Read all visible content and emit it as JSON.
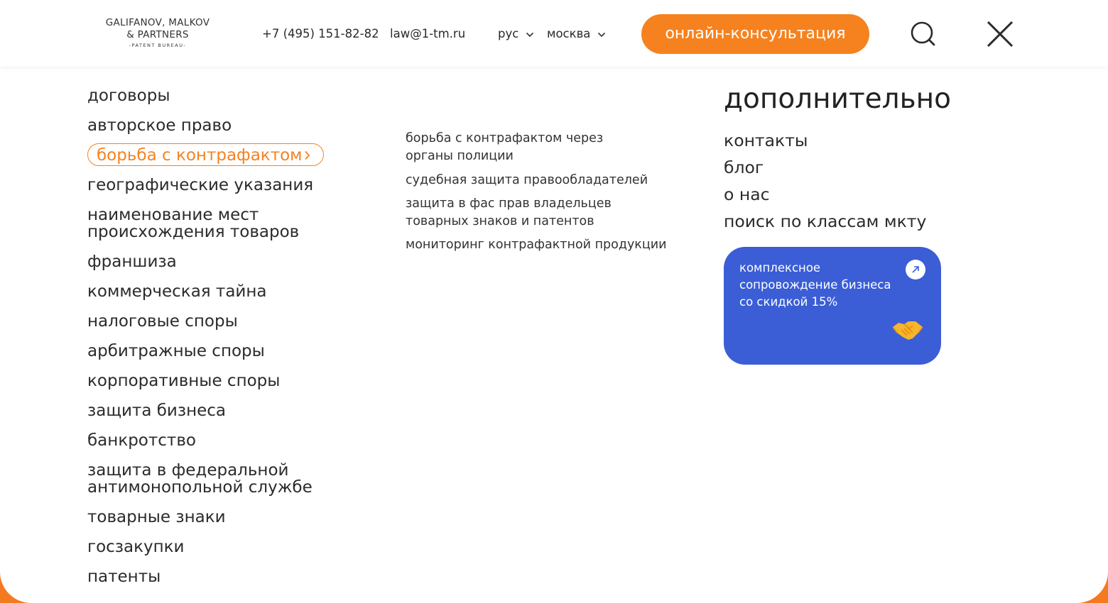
{
  "colors": {
    "accent": "#f6821f",
    "promo_bg": "#3b5ed6",
    "text": "#222222"
  },
  "header": {
    "logo": {
      "line1": "GALIFANOV, MALKOV",
      "line2": "& PARTNERS",
      "line3": "-PATENT BUREAU-"
    },
    "phone": "+7 (495) 151-82-82",
    "email": "law@1-tm.ru",
    "language": "рус",
    "city": "москва",
    "cta_label": "онлайн-консультация",
    "icons": [
      "search-icon",
      "close-icon"
    ]
  },
  "nav": {
    "items": [
      "договоры",
      "авторское право",
      "борьба с контрафактом",
      "географические указания",
      "наименование мест происхождения товаров",
      "франшиза",
      "коммерческая тайна",
      "налоговые споры",
      "арбитражные споры",
      "корпоративные споры",
      "защита бизнеса",
      "банкротство",
      "защита в федеральной антимонопольной службе",
      "товарные знаки",
      "госзакупки",
      "патенты"
    ],
    "active_index": 2
  },
  "submenu": {
    "items": [
      "борьба с контрафактом через органы полиции",
      "судебная защита правообладателей",
      "защита в фас прав владельцев товарных знаков и патентов",
      "мониторинг контрафактной продукции"
    ]
  },
  "extra": {
    "title": "дополнительно",
    "items": [
      "контакты",
      "блог",
      "о нас",
      "поиск по классам мкту"
    ],
    "promo": {
      "text": "комплексное сопровождение бизнеса со скидкой 15%",
      "icon": "handshake-icon",
      "arrow_icon": "arrow-up-right-icon"
    }
  }
}
